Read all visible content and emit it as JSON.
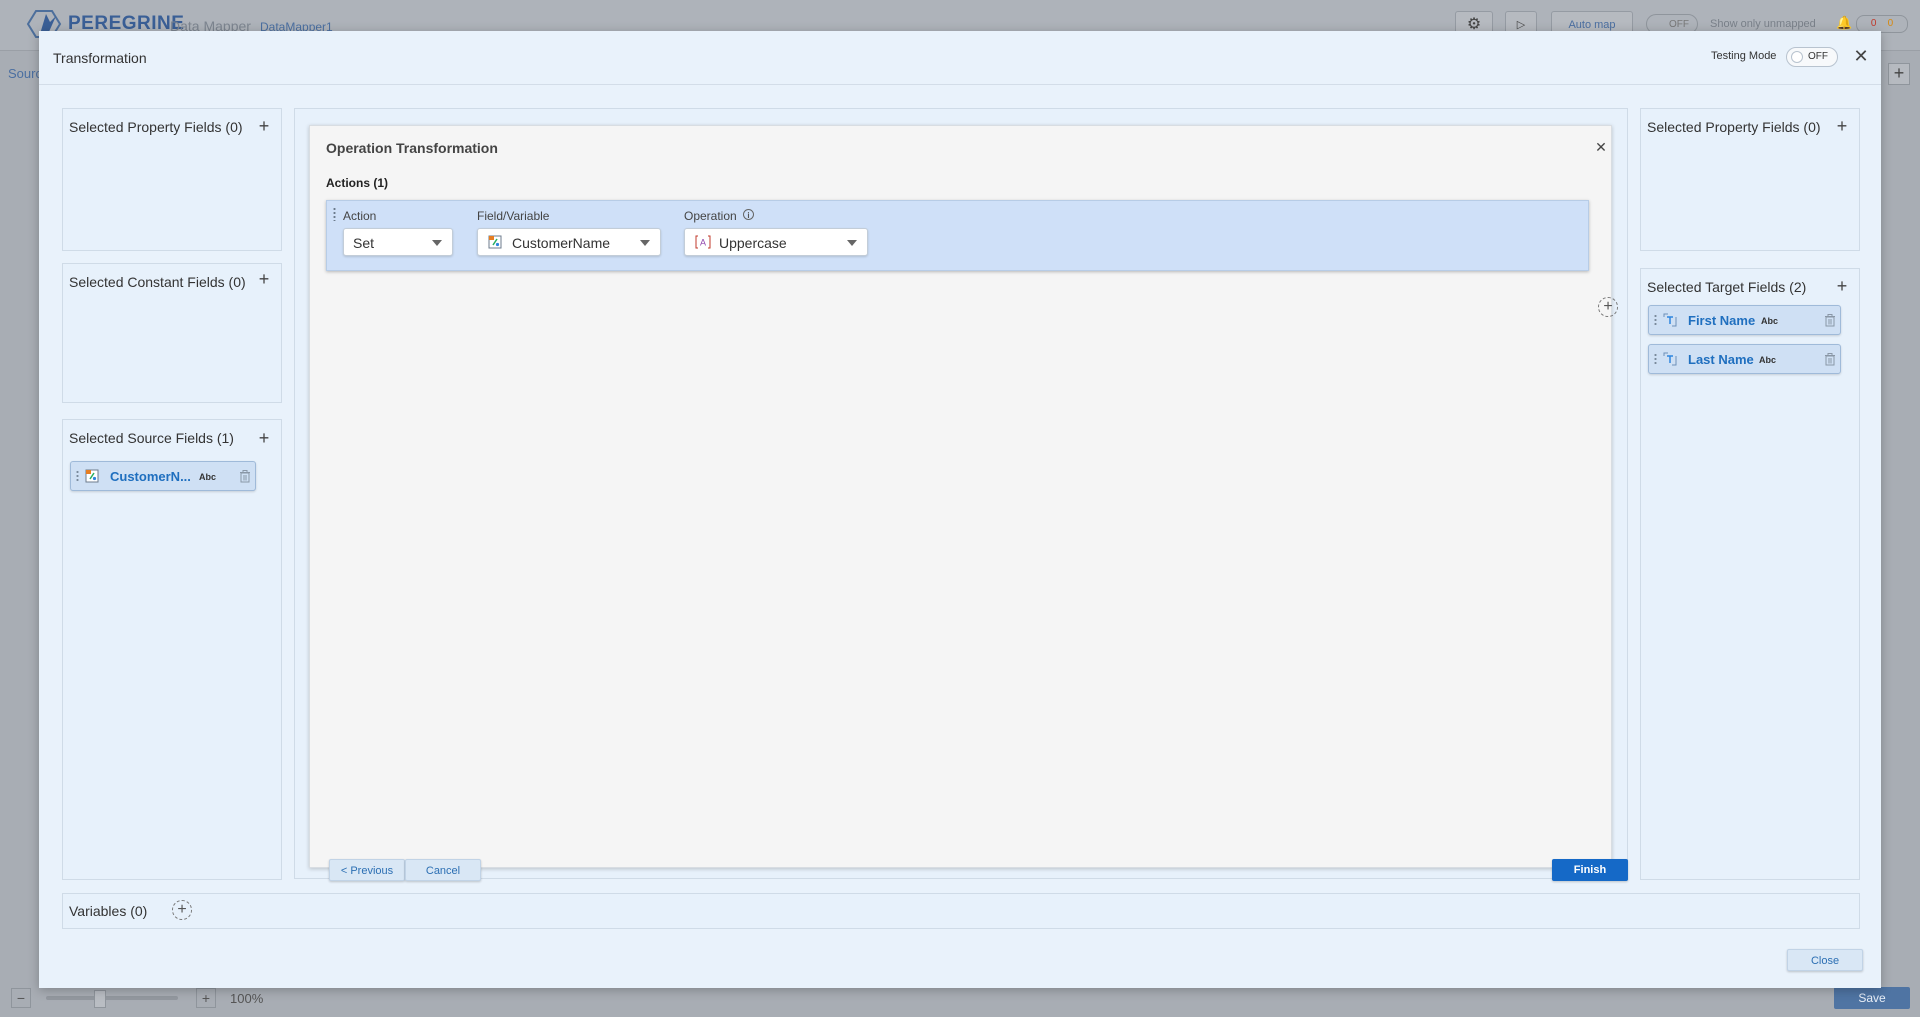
{
  "background": {
    "brand": "PEREGRINE",
    "product": "Data Mapper",
    "app_name": "DataMapper1",
    "auto_map": "Auto map",
    "toggle_off": "OFF",
    "show_unmapped": "Show only unmapped",
    "count_errors": "0",
    "count_warnings": "0",
    "source_tab": "Sourc",
    "zoom": "100%",
    "save": "Save"
  },
  "modal": {
    "title": "Transformation",
    "testing_mode_label": "Testing Mode",
    "testing_mode_state": "OFF"
  },
  "left_panels": {
    "property": {
      "title": "Selected Property Fields (0)"
    },
    "constant": {
      "title": "Selected Constant Fields (0)"
    },
    "source": {
      "title": "Selected Source Fields (1)",
      "fields": [
        {
          "label": "CustomerN...",
          "type": "Abc"
        }
      ]
    }
  },
  "operation": {
    "title": "Operation Transformation",
    "actions_title": "Actions (1)",
    "row": {
      "action_label": "Action",
      "action_value": "Set",
      "field_label": "Field/Variable",
      "field_value": "CustomerName",
      "operation_label": "Operation",
      "operation_value": "Uppercase"
    },
    "buttons": {
      "previous": "< Previous",
      "cancel": "Cancel",
      "finish": "Finish"
    }
  },
  "right_panels": {
    "property": {
      "title": "Selected Property Fields (0)"
    },
    "target": {
      "title": "Selected Target Fields (2)",
      "fields": [
        {
          "label": "First Name",
          "type": "Abc"
        },
        {
          "label": "Last Name",
          "type": "Abc"
        }
      ]
    }
  },
  "variables": {
    "title": "Variables (0)"
  },
  "footer": {
    "close": "Close"
  },
  "colors": {
    "accent": "#1569c7",
    "field_label": "#1f6fbf",
    "modal_bg": "#e9f2fb"
  }
}
